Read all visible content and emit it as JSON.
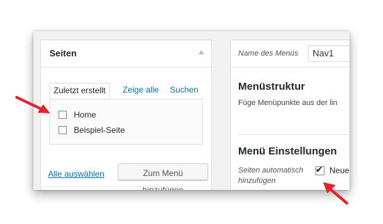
{
  "left_panel": {
    "title": "Seiten",
    "tabs": [
      {
        "label": "Zuletzt erstellt",
        "active": true
      },
      {
        "label": "Zeige alle",
        "active": false
      },
      {
        "label": "Suchen",
        "active": false
      }
    ],
    "items": [
      {
        "label": "Home",
        "checked": false
      },
      {
        "label": "Beispiel-Seite",
        "checked": false
      }
    ],
    "select_all": "Alle auswählen",
    "add_button": "Zum Menü hinzufügen"
  },
  "right_panel": {
    "menu_name_label": "Name des Menüs",
    "menu_name_value": "Nav1",
    "structure_title": "Menüstruktur",
    "structure_text": "Füge Menüpunkte aus der lin",
    "settings_title": "Menü Einstellungen",
    "auto_add_label": "Seiten automatisch hinzufügen",
    "auto_add_checked": true,
    "auto_add_text": "Neue"
  },
  "colors": {
    "link": "#0073aa",
    "arrow": "#e8202a",
    "background": "#f1f1f1"
  }
}
